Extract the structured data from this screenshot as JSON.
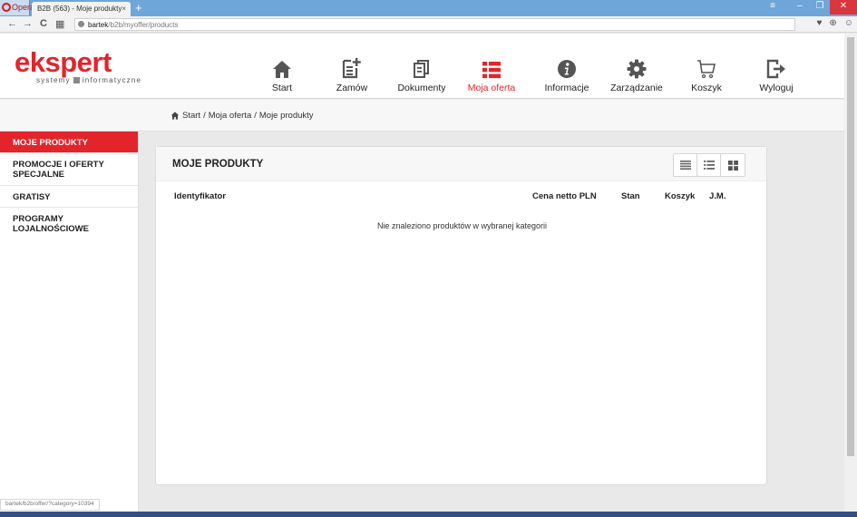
{
  "browser": {
    "opera_label": "Opera",
    "tab_title": "B2B (563) - Moje produkty",
    "tab_close": "×",
    "new_tab": "+",
    "url_host": "bartek",
    "url_path": "/b2b/myoffer/products",
    "status_url": "bartek/b2b/offer/?category=10394"
  },
  "logo": {
    "word": "ekspert",
    "sub_left": "systemy",
    "sub_right": "informatyczne"
  },
  "nav": [
    {
      "label": "Start",
      "icon": "home-icon"
    },
    {
      "label": "Zamów",
      "icon": "new-order-icon"
    },
    {
      "label": "Dokumenty",
      "icon": "documents-icon"
    },
    {
      "label": "Moja oferta",
      "icon": "list-icon",
      "active": true
    },
    {
      "label": "Informacje",
      "icon": "info-icon"
    },
    {
      "label": "Zarządzanie",
      "icon": "gear-icon"
    },
    {
      "label": "Koszyk",
      "icon": "cart-icon"
    },
    {
      "label": "Wyloguj",
      "icon": "logout-icon"
    }
  ],
  "breadcrumb": {
    "start": "Start",
    "sep": "/",
    "offer": "Moja oferta",
    "current": "Moje produkty"
  },
  "sidebar": {
    "items": [
      {
        "label": "MOJE PRODUKTY",
        "active": true
      },
      {
        "label": "PROMOCJE I OFERTY SPECJALNE"
      },
      {
        "label": "GRATISY"
      },
      {
        "label": "PROGRAMY LOJALNOŚCIOWE"
      }
    ]
  },
  "panel": {
    "title": "MOJE PRODUKTY",
    "columns": {
      "id": "Identyfikator",
      "price": "Cena netto PLN",
      "stock": "Stan",
      "cart": "Koszyk",
      "unit": "J.M."
    },
    "empty_message": "Nie znaleziono produktów w wybranej kategorii"
  },
  "colors": {
    "accent": "#e3242b",
    "icon_gray": "#555555"
  }
}
